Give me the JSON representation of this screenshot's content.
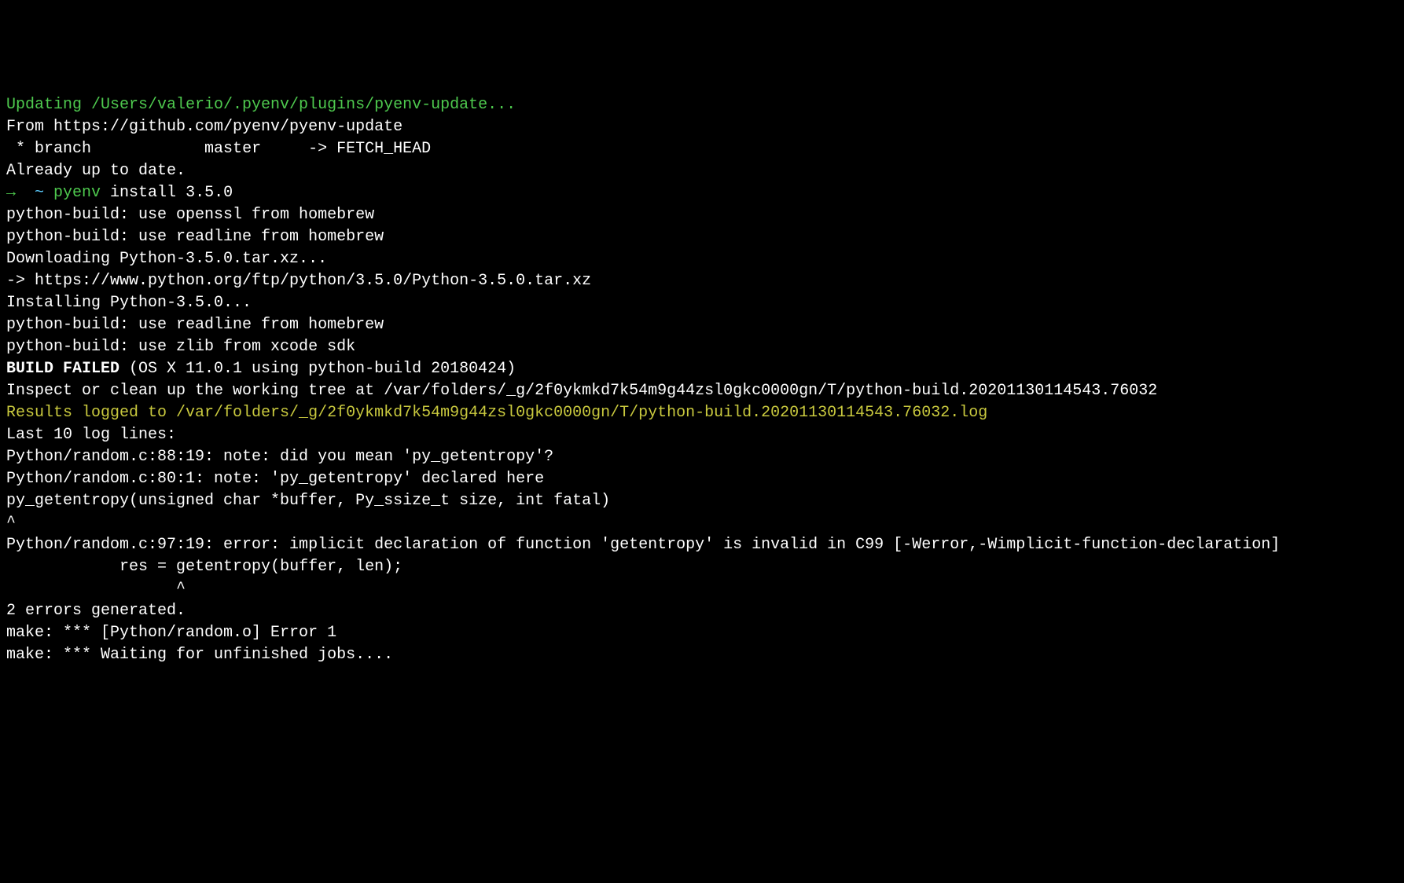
{
  "lines": {
    "l1": "Updating /Users/valerio/.pyenv/plugins/pyenv-update...",
    "l2": "From https://github.com/pyenv/pyenv-update",
    "l3": " * branch            master     -> FETCH_HEAD",
    "l4": "Already up to date.",
    "prompt_arrow": "→  ",
    "prompt_tilde": "~",
    "prompt_cmd": " pyenv",
    "prompt_args": " install 3.5.0",
    "l6": "python-build: use openssl from homebrew",
    "l7": "python-build: use readline from homebrew",
    "l8": "Downloading Python-3.5.0.tar.xz...",
    "l9": "-> https://www.python.org/ftp/python/3.5.0/Python-3.5.0.tar.xz",
    "l10": "Installing Python-3.5.0...",
    "l11": "python-build: use readline from homebrew",
    "l12": "python-build: use zlib from xcode sdk",
    "blank": "",
    "build_failed_bold": "BUILD FAILED",
    "build_failed_rest": " (OS X 11.0.1 using python-build 20180424)",
    "l15": "Inspect or clean up the working tree at /var/folders/_g/2f0ykmkd7k54m9g44zsl0gkc0000gn/T/python-build.20201130114543.76032",
    "l16": "Results logged to /var/folders/_g/2f0ykmkd7k54m9g44zsl0gkc0000gn/T/python-build.20201130114543.76032.log",
    "l18": "Last 10 log lines:",
    "l19": "Python/random.c:88:19: note: did you mean 'py_getentropy'?",
    "l20": "Python/random.c:80:1: note: 'py_getentropy' declared here",
    "l21": "py_getentropy(unsigned char *buffer, Py_ssize_t size, int fatal)",
    "l22": "^",
    "l23": "Python/random.c:97:19: error: implicit declaration of function 'getentropy' is invalid in C99 [-Werror,-Wimplicit-function-declaration]",
    "l24": "            res = getentropy(buffer, len);",
    "l25": "                  ^",
    "l26": "2 errors generated.",
    "l27": "make: *** [Python/random.o] Error 1",
    "l28": "make: *** Waiting for unfinished jobs...."
  }
}
